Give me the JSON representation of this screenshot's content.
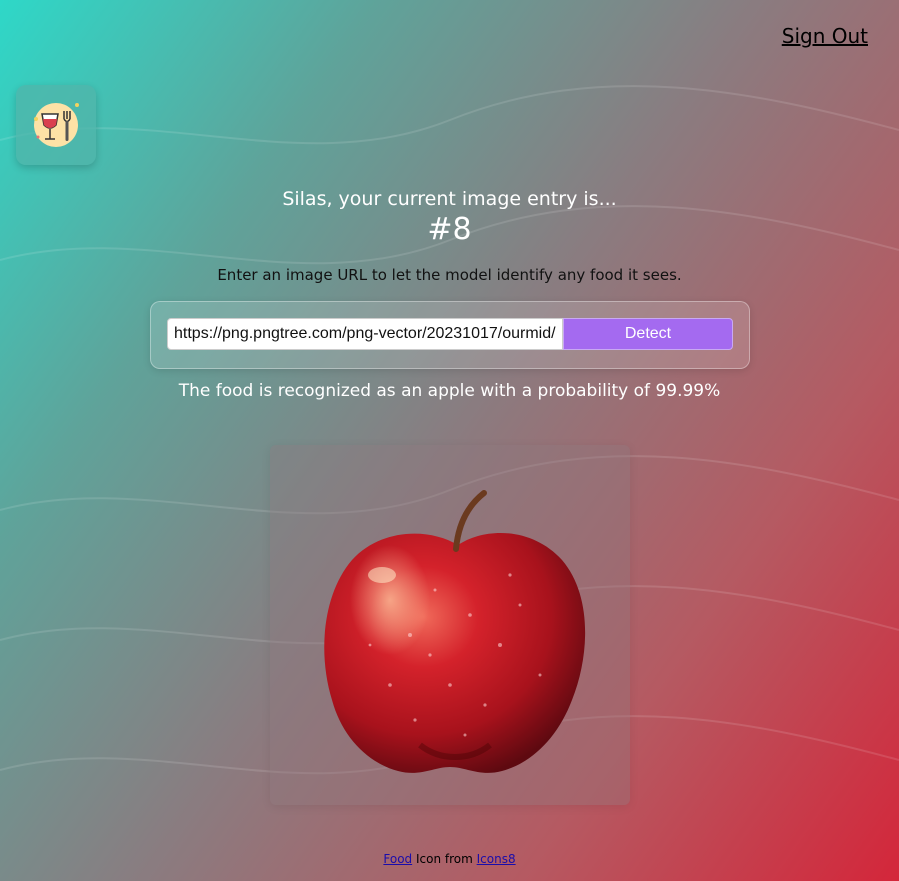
{
  "header": {
    "signout_label": "Sign Out"
  },
  "logo": {
    "icon": "wine-and-fork-icon"
  },
  "main": {
    "greeting": "Silas, your current image entry is...",
    "entry_count": "#8",
    "instructions": "Enter an image URL to let the model identify any food it sees.",
    "url_value": "https://png.pngtree.com/png-vector/20231017/ourmid/",
    "detect_label": "Detect",
    "result": "The food is recognized as an apple with a probability of 99.99%"
  },
  "image": {
    "subject": "apple-image"
  },
  "footer": {
    "food_link": "Food",
    "middle_text": "Icon from",
    "icons8_link": "Icons8"
  },
  "colors": {
    "gradient_start": "#2ed8c8",
    "gradient_end": "#d4263a",
    "detect_button": "#a46af0"
  }
}
